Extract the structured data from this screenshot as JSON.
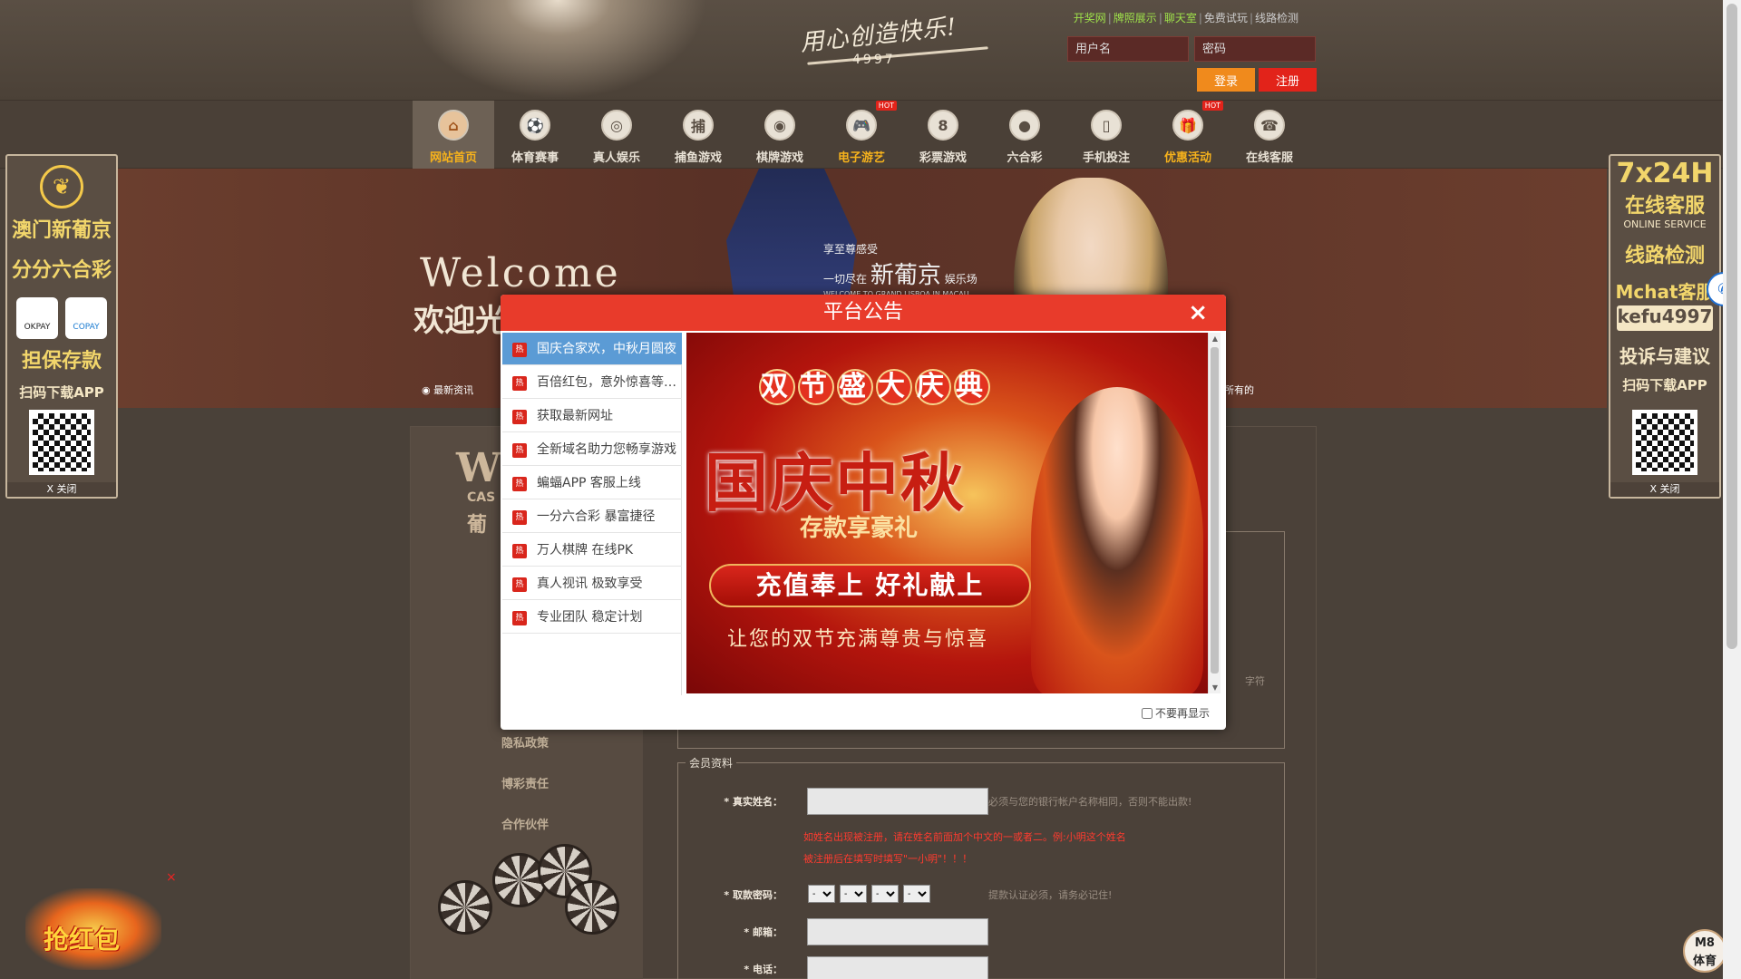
{
  "header": {
    "slogan": "用心创造快乐!",
    "brand_number": "4997",
    "links": [
      "开奖网",
      "牌照展示",
      "聊天室",
      "免费试玩",
      "线路检测"
    ],
    "username_placeholder": "用户名",
    "password_placeholder": "密码",
    "login_label": "登录",
    "register_label": "注册",
    "colors": {
      "login": "#f08a1c",
      "register": "#e2231a",
      "link_green": "#9ee04a"
    }
  },
  "nav": {
    "items": [
      {
        "label": "网站首页",
        "icon": "home-icon",
        "glyph": "⌂",
        "active": true,
        "hot": false
      },
      {
        "label": "体育赛事",
        "icon": "soccer-ball-icon",
        "glyph": "⚽",
        "active": false,
        "hot": false
      },
      {
        "label": "真人娱乐",
        "icon": "casino-chip-icon",
        "glyph": "◎",
        "active": false,
        "hot": false
      },
      {
        "label": "捕鱼游戏",
        "icon": "fishing-icon",
        "glyph": "捕",
        "active": false,
        "hot": false
      },
      {
        "label": "棋牌游戏",
        "icon": "cards-chip-icon",
        "glyph": "◉",
        "active": false,
        "hot": false
      },
      {
        "label": "电子游艺",
        "icon": "gamepad-icon",
        "glyph": "🎮",
        "active": false,
        "hot": true
      },
      {
        "label": "彩票游戏",
        "icon": "lottery-ball-icon",
        "glyph": "8",
        "active": false,
        "hot": false
      },
      {
        "label": "六合彩",
        "icon": "user-icon",
        "glyph": "●",
        "active": false,
        "hot": false
      },
      {
        "label": "手机投注",
        "icon": "mobile-icon",
        "glyph": "▯",
        "active": false,
        "hot": false
      },
      {
        "label": "优惠活动",
        "icon": "gift-icon",
        "glyph": "🎁",
        "active": false,
        "hot": true
      },
      {
        "label": "在线客服",
        "icon": "support-icon",
        "glyph": "☎",
        "active": false,
        "hot": false
      }
    ],
    "hot_badge": "HOT"
  },
  "banner": {
    "welcome_en": "Welcome",
    "welcome_cn": "欢迎光临",
    "tag_line1": "享至尊感受",
    "tag_line2": "一切尽在",
    "tag_big": "新葡京",
    "tag_suffix": "娱乐场",
    "tag_en": "WELCOME TO GRAND LISBOA IN MACAU",
    "news_label": "最新资讯",
    "news_right": "所有的"
  },
  "left_panel": {
    "title1": "澳门新葡京",
    "title2": "分分六合彩",
    "pay1": "OKPAY",
    "pay2": "COPAY",
    "guarantee": "担保存款",
    "download": "扫码下载APP",
    "close": "X 关闭"
  },
  "right_panel": {
    "hours": "7x24H",
    "service": "在线客服",
    "online_en": "ONLINE SERVICE",
    "line_check": "线路检测",
    "mchat": "Mchat客服",
    "mchat_id": "kefu4997",
    "feedback": "投诉与建议",
    "download": "扫码下载APP",
    "close": "X 关闭"
  },
  "side_menu": {
    "logo_big": "W",
    "logo_casino": "CAS",
    "logo_cn": "葡",
    "links": [
      "隐私政策",
      "博彩责任",
      "合作伙伴"
    ]
  },
  "form": {
    "hint_top": "字符",
    "member_legend": "会员资料",
    "real_name_label": "* 真实姓名：",
    "real_name_hint": "必须与您的银行帐户名称相同，否则不能出款!",
    "red_note1": "如姓名出现被注册，请在姓名前面加个中文的一或者二。例:小明这个姓名",
    "red_note2": "被注册后在填写时填写\"一小明\"！！！",
    "pin_label": "* 取款密码：",
    "pin_option": "-",
    "pin_hint": "提款认证必须，请务必记住!",
    "email_label": "* 邮箱：",
    "phone_label": "* 电话："
  },
  "modal": {
    "title": "平台公告",
    "close": "×",
    "hot_icon_text": "热",
    "announcements": [
      "国庆合家欢，中秋月圆夜",
      "百倍红包，意外惊喜等你拿",
      "获取最新网址",
      "全新域名助力您畅享游戏",
      "蝙蝠APP 客服上线",
      "一分六合彩 暴富捷径",
      "万人棋牌 在线PK",
      "真人视讯 极致享受",
      "专业团队 稳定计划"
    ],
    "active_index": 0,
    "image": {
      "top_chars": [
        "双",
        "节",
        "盛",
        "大",
        "庆",
        "典"
      ],
      "main": "国庆中秋",
      "sub": "存款享豪礼",
      "button": "充值奉上 好礼献上",
      "foot": "让您的双节充满尊贵与惊喜"
    },
    "dont_show": "不要再显示"
  },
  "floating": {
    "wechat_icon": "wechat-icon",
    "m8_label": "M8\n体育",
    "redpack_text": "抢红包",
    "redpack_close": "×"
  }
}
